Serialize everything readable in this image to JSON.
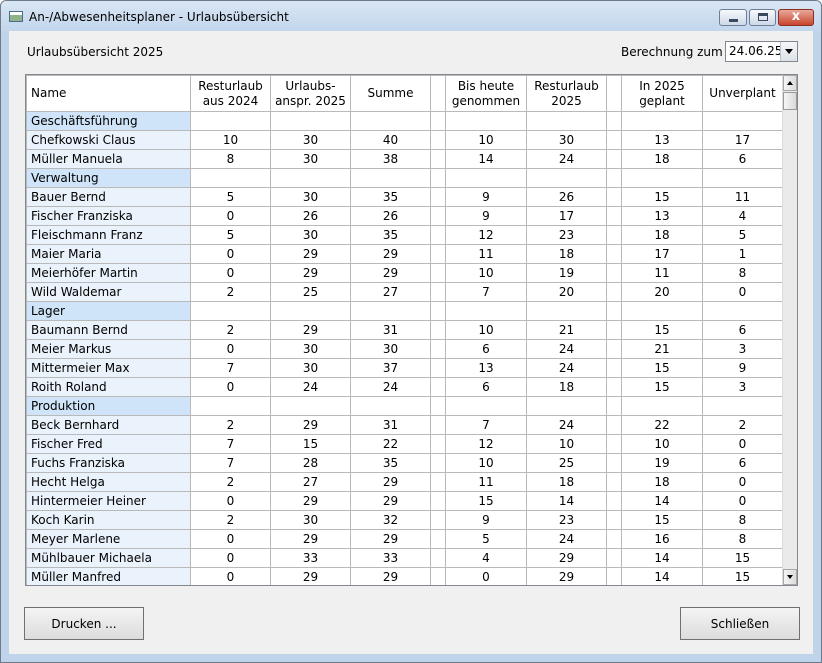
{
  "window": {
    "title": "An-/Abwesenheitsplaner - Urlaubsübersicht",
    "minimize_label": "_",
    "maximize_label": "□",
    "close_label": "x"
  },
  "header": {
    "heading": "Urlaubsübersicht 2025",
    "calc_label": "Berechnung zum",
    "calc_date": "24.06.25"
  },
  "table": {
    "columns": [
      {
        "l1": "Name",
        "l2": ""
      },
      {
        "l1": "Resturlaub",
        "l2": "aus 2024"
      },
      {
        "l1": "Urlaubs-",
        "l2": "anspr. 2025"
      },
      {
        "l1": "Summe",
        "l2": ""
      },
      {
        "l1": "",
        "l2": ""
      },
      {
        "l1": "Bis heute",
        "l2": "genommen"
      },
      {
        "l1": "Resturlaub",
        "l2": "2025"
      },
      {
        "l1": "",
        "l2": ""
      },
      {
        "l1": "In 2025",
        "l2": "geplant"
      },
      {
        "l1": "Unverplant",
        "l2": ""
      }
    ],
    "rows": [
      {
        "group": true,
        "cells": [
          "Geschäftsführung",
          "",
          "",
          "",
          "",
          "",
          "",
          "",
          "",
          ""
        ]
      },
      {
        "group": false,
        "cells": [
          "Chefkowski Claus",
          "10",
          "30",
          "40",
          "",
          "10",
          "30",
          "",
          "13",
          "17"
        ]
      },
      {
        "group": false,
        "cells": [
          "Müller Manuela",
          "8",
          "30",
          "38",
          "",
          "14",
          "24",
          "",
          "18",
          "6"
        ]
      },
      {
        "group": true,
        "cells": [
          "Verwaltung",
          "",
          "",
          "",
          "",
          "",
          "",
          "",
          "",
          ""
        ]
      },
      {
        "group": false,
        "cells": [
          "Bauer Bernd",
          "5",
          "30",
          "35",
          "",
          "9",
          "26",
          "",
          "15",
          "11"
        ]
      },
      {
        "group": false,
        "cells": [
          "Fischer Franziska",
          "0",
          "26",
          "26",
          "",
          "9",
          "17",
          "",
          "13",
          "4"
        ]
      },
      {
        "group": false,
        "cells": [
          "Fleischmann Franz",
          "5",
          "30",
          "35",
          "",
          "12",
          "23",
          "",
          "18",
          "5"
        ]
      },
      {
        "group": false,
        "cells": [
          "Maier Maria",
          "0",
          "29",
          "29",
          "",
          "11",
          "18",
          "",
          "17",
          "1"
        ]
      },
      {
        "group": false,
        "cells": [
          "Meierhöfer Martin",
          "0",
          "29",
          "29",
          "",
          "10",
          "19",
          "",
          "11",
          "8"
        ]
      },
      {
        "group": false,
        "cells": [
          "Wild Waldemar",
          "2",
          "25",
          "27",
          "",
          "7",
          "20",
          "",
          "20",
          "0"
        ]
      },
      {
        "group": true,
        "cells": [
          "Lager",
          "",
          "",
          "",
          "",
          "",
          "",
          "",
          "",
          ""
        ]
      },
      {
        "group": false,
        "cells": [
          "Baumann Bernd",
          "2",
          "29",
          "31",
          "",
          "10",
          "21",
          "",
          "15",
          "6"
        ]
      },
      {
        "group": false,
        "cells": [
          "Meier Markus",
          "0",
          "30",
          "30",
          "",
          "6",
          "24",
          "",
          "21",
          "3"
        ]
      },
      {
        "group": false,
        "cells": [
          "Mittermeier Max",
          "7",
          "30",
          "37",
          "",
          "13",
          "24",
          "",
          "15",
          "9"
        ]
      },
      {
        "group": false,
        "cells": [
          "Roith Roland",
          "0",
          "24",
          "24",
          "",
          "6",
          "18",
          "",
          "15",
          "3"
        ]
      },
      {
        "group": true,
        "cells": [
          "Produktion",
          "",
          "",
          "",
          "",
          "",
          "",
          "",
          "",
          ""
        ]
      },
      {
        "group": false,
        "cells": [
          "Beck Bernhard",
          "2",
          "29",
          "31",
          "",
          "7",
          "24",
          "",
          "22",
          "2"
        ]
      },
      {
        "group": false,
        "cells": [
          "Fischer Fred",
          "7",
          "15",
          "22",
          "",
          "12",
          "10",
          "",
          "10",
          "0"
        ]
      },
      {
        "group": false,
        "cells": [
          "Fuchs Franziska",
          "7",
          "28",
          "35",
          "",
          "10",
          "25",
          "",
          "19",
          "6"
        ]
      },
      {
        "group": false,
        "cells": [
          "Hecht Helga",
          "2",
          "27",
          "29",
          "",
          "11",
          "18",
          "",
          "18",
          "0"
        ]
      },
      {
        "group": false,
        "cells": [
          "Hintermeier Heiner",
          "0",
          "29",
          "29",
          "",
          "15",
          "14",
          "",
          "14",
          "0"
        ]
      },
      {
        "group": false,
        "cells": [
          "Koch Karin",
          "2",
          "30",
          "32",
          "",
          "9",
          "23",
          "",
          "15",
          "8"
        ]
      },
      {
        "group": false,
        "cells": [
          "Meyer Marlene",
          "0",
          "29",
          "29",
          "",
          "5",
          "24",
          "",
          "16",
          "8"
        ]
      },
      {
        "group": false,
        "cells": [
          "Mühlbauer Michaela",
          "0",
          "33",
          "33",
          "",
          "4",
          "29",
          "",
          "14",
          "15"
        ]
      },
      {
        "group": false,
        "cells": [
          "Müller Manfred",
          "0",
          "29",
          "29",
          "",
          "0",
          "29",
          "",
          "14",
          "15"
        ]
      }
    ]
  },
  "buttons": {
    "print": "Drucken ...",
    "close": "Schließen"
  }
}
